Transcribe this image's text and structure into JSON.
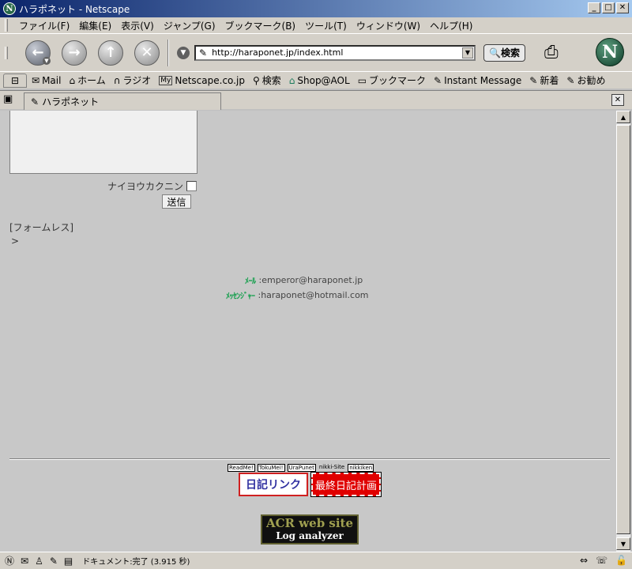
{
  "window": {
    "title": "ハラポネット - Netscape",
    "app_icon": "netscape-icon",
    "controls": [
      "minimize",
      "maximize",
      "close"
    ]
  },
  "menu": [
    "ファイル(F)",
    "編集(E)",
    "表示(V)",
    "ジャンプ(G)",
    "ブックマーク(B)",
    "ツール(T)",
    "ウィンドウ(W)",
    "ヘルプ(H)"
  ],
  "nav": {
    "url": "http://haraponet.jp/index.html",
    "search_label": "検索"
  },
  "personal_toolbar": [
    {
      "label": "Mail",
      "icon": "mail-icon"
    },
    {
      "label": "ホーム",
      "icon": "home-icon"
    },
    {
      "label": "ラジオ",
      "icon": "headphones-icon"
    },
    {
      "label": "Netscape.co.jp",
      "icon": "my-icon"
    },
    {
      "label": "検索",
      "icon": "search-icon"
    },
    {
      "label": "Shop@AOL",
      "icon": "shop-icon"
    },
    {
      "label": "ブックマーク",
      "icon": "folder-icon"
    },
    {
      "label": "Instant Message",
      "icon": "link-icon"
    },
    {
      "label": "新着",
      "icon": "link-icon"
    },
    {
      "label": "お勧め",
      "icon": "link-icon"
    }
  ],
  "tab": {
    "label": "ハラポネット"
  },
  "page": {
    "confirm_label": "ナイヨウカクニン",
    "send_label": "送信",
    "formless": "[フォームレス]",
    "gt": ">",
    "contacts": [
      {
        "label": "ﾒｰﾙ",
        "value": ":emperor@haraponet.jp"
      },
      {
        "label": "ﾒｯｾﾝｼﾞｬｰ",
        "value": ":haraponet@hotmail.com"
      }
    ],
    "mini_links": [
      "ReadMe!",
      "TokuMei!",
      "UraPunet",
      "nikki-Site",
      "nikkiken"
    ],
    "banners": {
      "nikki_link": "日記リンク",
      "last_diary": "最終日記計画",
      "acr_line1": "ACR web site",
      "acr_line2": "Log analyzer"
    }
  },
  "status": {
    "text": "ドキュメント:完了 (3.915 秒)"
  }
}
